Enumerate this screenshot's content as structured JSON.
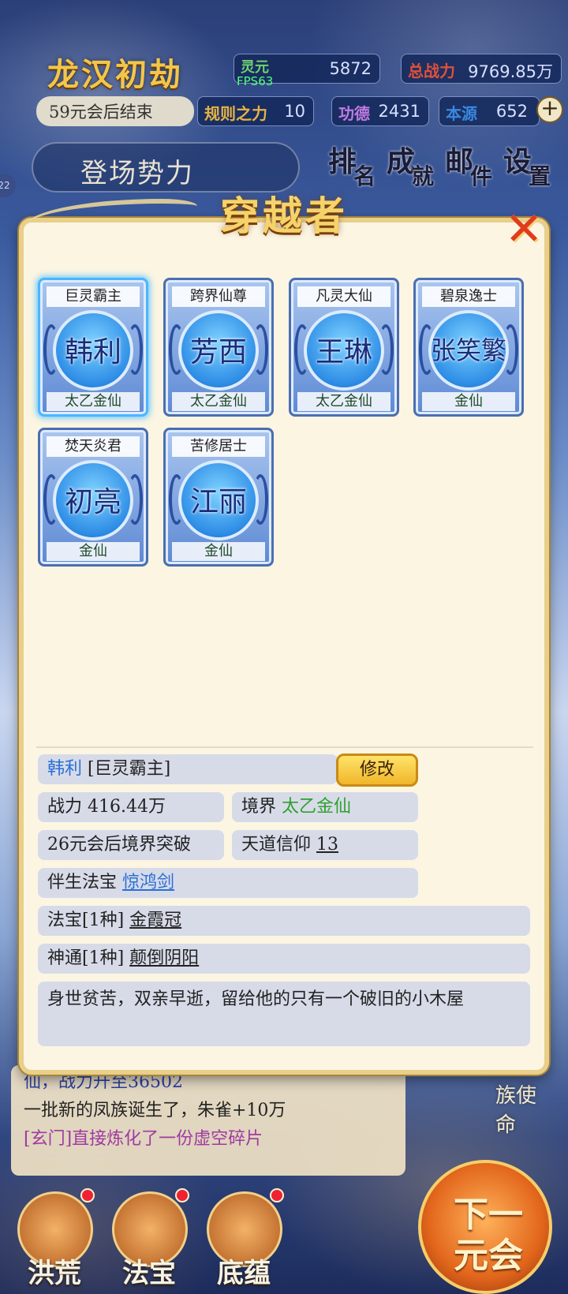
{
  "hud": {
    "title": "龙汉初劫",
    "subtitle": "59元会后结束",
    "fps": "FPS63",
    "stats": {
      "lingyuan_label": "灵元",
      "lingyuan_value": "5872",
      "power_label": "总战力",
      "power_value": "9769.85万",
      "rule_label": "规则之力",
      "rule_value": "10",
      "merit_label": "功德",
      "merit_value": "2431",
      "source_label": "本源",
      "source_value": "652"
    },
    "plus": "+",
    "faction_button": "登场势力",
    "menu": [
      {
        "c1": "排",
        "c2": "名"
      },
      {
        "c1": "成",
        "c2": "就"
      },
      {
        "c1": "邮",
        "c2": "件"
      },
      {
        "c1": "设",
        "c2": "置"
      }
    ],
    "side_badge": "22"
  },
  "modal": {
    "title": "穿越者",
    "close": "✕",
    "cards": [
      {
        "title": "巨灵霸主",
        "name": "韩利",
        "realm": "太乙金仙"
      },
      {
        "title": "跨界仙尊",
        "name": "芳西",
        "realm": "太乙金仙"
      },
      {
        "title": "凡灵大仙",
        "name": "王琳",
        "realm": "太乙金仙"
      },
      {
        "title": "碧泉逸士",
        "name": "张笑繁",
        "realm": "金仙"
      },
      {
        "title": "焚天炎君",
        "name": "初亮",
        "realm": "金仙"
      },
      {
        "title": "苦修居士",
        "name": "江丽",
        "realm": "金仙"
      }
    ],
    "detail": {
      "name": "韩利",
      "title": "[巨灵霸主]",
      "edit_button": "修改",
      "power_label": "战力",
      "power_value": "416.44万",
      "realm_label": "境界",
      "realm_value": "太乙金仙",
      "breakthrough": "26元会后境界突破",
      "faith_label": "天道信仰",
      "faith_value": "13",
      "companion_label": "伴生法宝",
      "companion_value": "惊鸿剑",
      "treasure_label": "法宝[1种]",
      "treasure_value": "金霞冠",
      "ability_label": "神通[1种]",
      "ability_value": "颠倒阴阳",
      "bio": "身世贫苦，双亲早逝，留给他的只有一个破旧的小木屋"
    }
  },
  "log": {
    "line1": "仙，战力升至36502",
    "line2": "一批新的凤族诞生了，朱雀+10万",
    "line3": "[玄门]直接炼化了一份虚空碎片"
  },
  "footer": {
    "mission": "族使命",
    "next": "下一元会",
    "nav": [
      "洪荒",
      "法宝",
      "底蕴"
    ]
  }
}
